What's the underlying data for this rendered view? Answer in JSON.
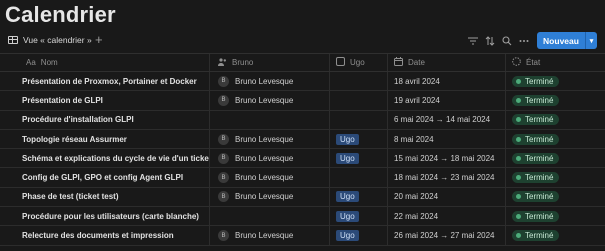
{
  "page": {
    "title": "Calendrier"
  },
  "viewbar": {
    "view_label": "Vue « calendrier »",
    "add_label": "+",
    "new_button": "Nouveau",
    "tools": [
      "filter-icon",
      "sort-icon",
      "search-icon",
      "more-icon"
    ]
  },
  "columns": {
    "name": {
      "icon": "Aa",
      "label": "Nom"
    },
    "bruno": {
      "label": "Bruno"
    },
    "ugo": {
      "label": "Ugo"
    },
    "date": {
      "label": "Date"
    },
    "etat": {
      "label": "État"
    }
  },
  "rows": [
    {
      "name": "Présentation de Proxmox, Portainer et Docker",
      "bruno": "Bruno Levesque",
      "bruno_initial": "B",
      "ugo": "",
      "date": "18 avril 2024",
      "etat": "Terminé"
    },
    {
      "name": "Présentation de GLPI",
      "bruno": "Bruno Levesque",
      "bruno_initial": "B",
      "ugo": "",
      "date": "19 avril 2024",
      "etat": "Terminé"
    },
    {
      "name": "Procédure d'installation GLPI",
      "bruno": "",
      "bruno_initial": "",
      "ugo": "",
      "date": "6 mai 2024 → 14 mai 2024",
      "etat": "Terminé"
    },
    {
      "name": "Topologie réseau Assurmer",
      "bruno": "Bruno Levesque",
      "bruno_initial": "B",
      "ugo": "Ugo",
      "date": "8 mai 2024",
      "etat": "Terminé"
    },
    {
      "name": "Schéma et explications du cycle de vie d'un ticket",
      "bruno": "Bruno Levesque",
      "bruno_initial": "B",
      "ugo": "Ugo",
      "date": "15 mai 2024 → 18 mai 2024",
      "etat": "Terminé"
    },
    {
      "name": "Config de GLPI, GPO et config Agent GLPI",
      "bruno": "Bruno Levesque",
      "bruno_initial": "B",
      "ugo": "",
      "date": "18 mai 2024 → 23 mai 2024",
      "etat": "Terminé"
    },
    {
      "name": "Phase de test (ticket test)",
      "bruno": "Bruno Levesque",
      "bruno_initial": "B",
      "ugo": "Ugo",
      "date": "20 mai 2024",
      "etat": "Terminé"
    },
    {
      "name": "Procédure pour les utilisateurs (carte blanche)",
      "bruno": "",
      "bruno_initial": "",
      "ugo": "Ugo",
      "date": "22 mai 2024",
      "etat": "Terminé"
    },
    {
      "name": "Relecture des documents et impression",
      "bruno": "Bruno Levesque",
      "bruno_initial": "B",
      "ugo": "Ugo",
      "date": "26 mai 2024 → 27 mai 2024",
      "etat": "Terminé"
    }
  ]
}
